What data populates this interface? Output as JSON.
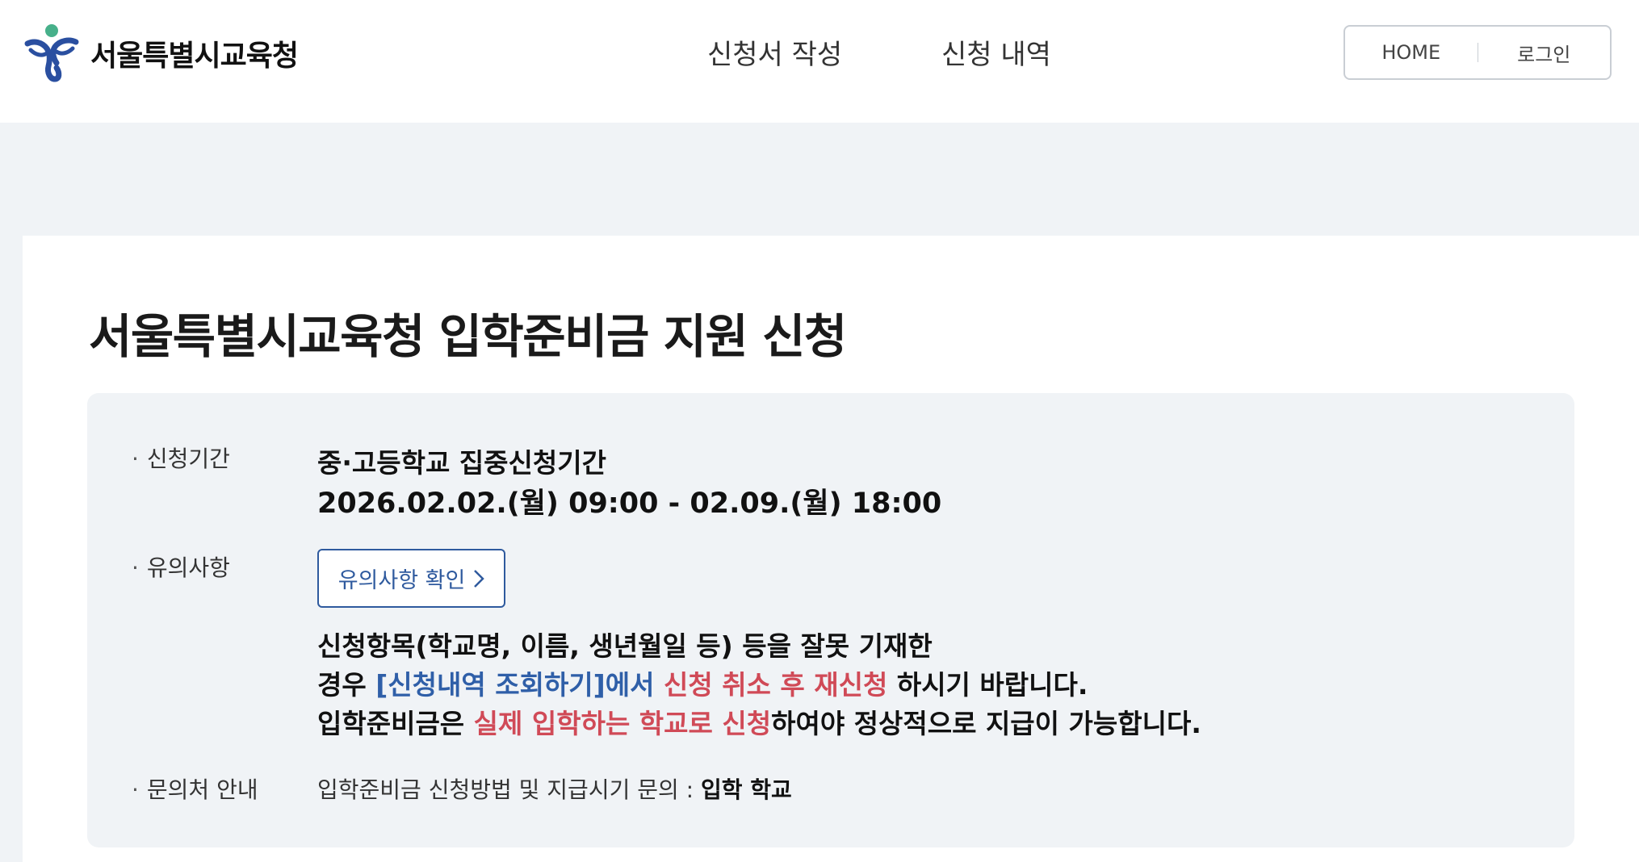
{
  "header": {
    "logo_text": "서울특별시교육청",
    "logo_icon": "seoul-education-logo",
    "nav": [
      "신청서 작성",
      "신청 내역"
    ],
    "util": {
      "home": "HOME",
      "login": "로그인"
    }
  },
  "main": {
    "title": "서울특별시교육청 입학준비금 지원 신청",
    "period": {
      "label": "신청기간",
      "title": "중·고등학교 집중신청기간",
      "dates": "2026.02.02.(월) 09:00 - 02.09.(월) 18:00"
    },
    "notice": {
      "label": "유의사항",
      "button": "유의사항 확인",
      "line1": "신청항목(학교명, 이름, 생년월일 등) 등을 잘못 기재한",
      "line2_pre": "경우 ",
      "line2_blue": "[신청내역 조회하기]에서",
      "line2_space": " ",
      "line2_red": "신청 취소 후 재신청",
      "line2_post": " 하시기 바랍니다.",
      "line3_pre": "입학준비금은 ",
      "line3_red": "실제 입학하는 학교로 신청",
      "line3_post": "하여야 정상적으로 지급이 가능합니다."
    },
    "contact": {
      "label": "문의처 안내",
      "text": "입학준비금 신청방법 및 지급시기 문의 : ",
      "bold": "입학 학교"
    }
  },
  "colors": {
    "background": "#f0f3f6",
    "accent_blue": "#2f5fa8",
    "accent_red": "#d04a57",
    "logo_blue": "#2a4fa0",
    "logo_green": "#47b08a"
  }
}
